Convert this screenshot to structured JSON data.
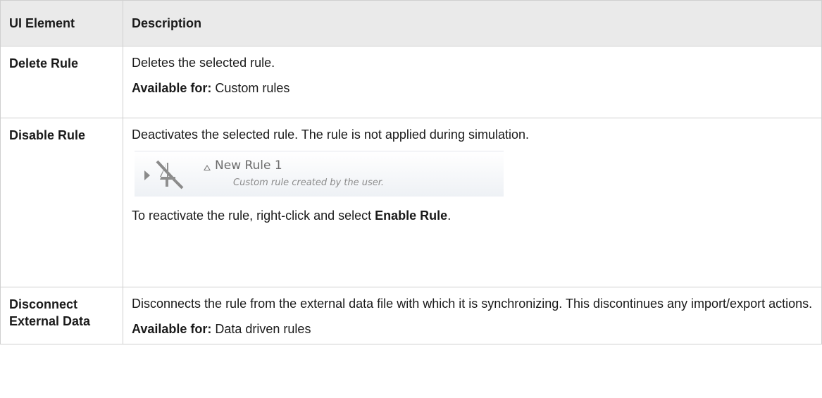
{
  "table": {
    "header": {
      "col1": "UI Element",
      "col2": "Description"
    },
    "rows": [
      {
        "name": "Delete Rule",
        "description": "Deletes the selected rule.",
        "available_label": "Available for:",
        "available_value": " Custom rules"
      },
      {
        "name": "Disable Rule",
        "description": "Deactivates the selected rule. The rule is not applied during simulation.",
        "screenshot": {
          "rule_title": "New Rule 1",
          "rule_subtitle": "Custom rule created by the user."
        },
        "note_prefix": "To reactivate the rule, right-click and select ",
        "note_bold": "Enable Rule",
        "note_suffix": "."
      },
      {
        "name": "Disconnect External Data",
        "description": "Disconnects the rule from the external data file with which it is synchronizing. This discontinues any import/export actions.",
        "available_label": "Available for:",
        "available_value": " Data driven rules"
      }
    ]
  }
}
